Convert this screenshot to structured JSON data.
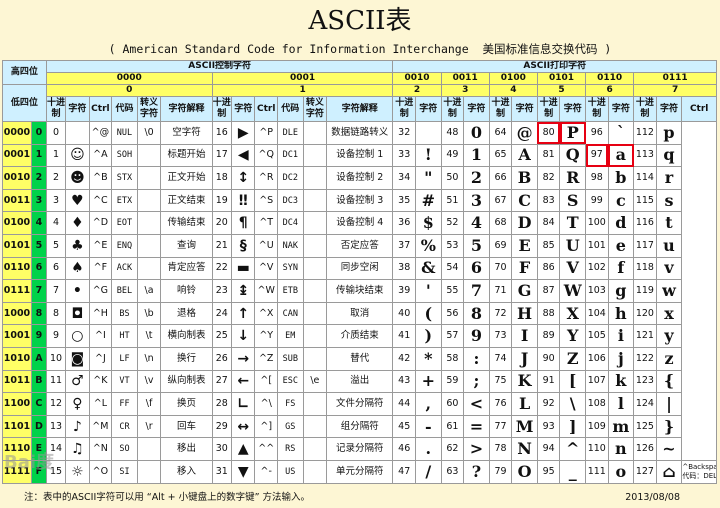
{
  "title": "ASCII表",
  "subtitle": "( American Standard Code for Information Interchange  美国标准信息交换代码 )",
  "corner_top": "高四位",
  "corner_bottom": "低四位",
  "ctrl_group": "ASCII控制字符",
  "print_group": "ASCII打印字符",
  "hi_bin": [
    "0000",
    "0001",
    "0010",
    "0011",
    "0100",
    "0101",
    "0110",
    "0111"
  ],
  "hi_hex": [
    "0",
    "1",
    "2",
    "3",
    "4",
    "5",
    "6",
    "7"
  ],
  "col_dec": "十进制",
  "col_char": "字符",
  "col_ctrl": "Ctrl",
  "col_code": "代码",
  "col_esc": "转义字符",
  "col_desc": "字符解释",
  "highlights": [
    [
      3,
      0
    ],
    [
      4,
      1
    ],
    [
      6,
      1
    ]
  ],
  "rows": [
    {
      "bin": "0000",
      "hex": "0",
      "c0": [
        "0",
        "",
        "^@",
        "NUL",
        "\\0",
        "空字符"
      ],
      "c1": [
        "16",
        "▶",
        "^P",
        "DLE",
        "",
        "数据链路转义"
      ],
      "p": [
        [
          "32",
          ""
        ],
        [
          "48",
          "0"
        ],
        [
          "64",
          "@"
        ],
        [
          "80",
          "P"
        ],
        [
          "96",
          "`"
        ],
        [
          "112",
          "p"
        ]
      ]
    },
    {
      "bin": "0001",
      "hex": "1",
      "c0": [
        "1",
        "☺",
        "^A",
        "SOH",
        "",
        "标题开始"
      ],
      "c1": [
        "17",
        "◀",
        "^Q",
        "DC1",
        "",
        "设备控制 1"
      ],
      "p": [
        [
          "33",
          "!"
        ],
        [
          "49",
          "1"
        ],
        [
          "65",
          "A"
        ],
        [
          "81",
          "Q"
        ],
        [
          "97",
          "a"
        ],
        [
          "113",
          "q"
        ]
      ]
    },
    {
      "bin": "0010",
      "hex": "2",
      "c0": [
        "2",
        "☻",
        "^B",
        "STX",
        "",
        "正文开始"
      ],
      "c1": [
        "18",
        "↕",
        "^R",
        "DC2",
        "",
        "设备控制 2"
      ],
      "p": [
        [
          "34",
          "\""
        ],
        [
          "50",
          "2"
        ],
        [
          "66",
          "B"
        ],
        [
          "82",
          "R"
        ],
        [
          "98",
          "b"
        ],
        [
          "114",
          "r"
        ]
      ]
    },
    {
      "bin": "0011",
      "hex": "3",
      "c0": [
        "3",
        "♥",
        "^C",
        "ETX",
        "",
        "正文结束"
      ],
      "c1": [
        "19",
        "‼",
        "^S",
        "DC3",
        "",
        "设备控制 3"
      ],
      "p": [
        [
          "35",
          "#"
        ],
        [
          "51",
          "3"
        ],
        [
          "67",
          "C"
        ],
        [
          "83",
          "S"
        ],
        [
          "99",
          "c"
        ],
        [
          "115",
          "s"
        ]
      ]
    },
    {
      "bin": "0100",
      "hex": "4",
      "c0": [
        "4",
        "♦",
        "^D",
        "EOT",
        "",
        "传输结束"
      ],
      "c1": [
        "20",
        "¶",
        "^T",
        "DC4",
        "",
        "设备控制 4"
      ],
      "p": [
        [
          "36",
          "$"
        ],
        [
          "52",
          "4"
        ],
        [
          "68",
          "D"
        ],
        [
          "84",
          "T"
        ],
        [
          "100",
          "d"
        ],
        [
          "116",
          "t"
        ]
      ]
    },
    {
      "bin": "0101",
      "hex": "5",
      "c0": [
        "5",
        "♣",
        "^E",
        "ENQ",
        "",
        "查询"
      ],
      "c1": [
        "21",
        "§",
        "^U",
        "NAK",
        "",
        "否定应答"
      ],
      "p": [
        [
          "37",
          "%"
        ],
        [
          "53",
          "5"
        ],
        [
          "69",
          "E"
        ],
        [
          "85",
          "U"
        ],
        [
          "101",
          "e"
        ],
        [
          "117",
          "u"
        ]
      ]
    },
    {
      "bin": "0110",
      "hex": "6",
      "c0": [
        "6",
        "♠",
        "^F",
        "ACK",
        "",
        "肯定应答"
      ],
      "c1": [
        "22",
        "▬",
        "^V",
        "SYN",
        "",
        "同步空闲"
      ],
      "p": [
        [
          "38",
          "&"
        ],
        [
          "54",
          "6"
        ],
        [
          "70",
          "F"
        ],
        [
          "86",
          "V"
        ],
        [
          "102",
          "f"
        ],
        [
          "118",
          "v"
        ]
      ]
    },
    {
      "bin": "0111",
      "hex": "7",
      "c0": [
        "7",
        "•",
        "^G",
        "BEL",
        "\\a",
        "响铃"
      ],
      "c1": [
        "23",
        "↨",
        "^W",
        "ETB",
        "",
        "传输块结束"
      ],
      "p": [
        [
          "39",
          "'"
        ],
        [
          "55",
          "7"
        ],
        [
          "71",
          "G"
        ],
        [
          "87",
          "W"
        ],
        [
          "103",
          "g"
        ],
        [
          "119",
          "w"
        ]
      ]
    },
    {
      "bin": "1000",
      "hex": "8",
      "c0": [
        "8",
        "◘",
        "^H",
        "BS",
        "\\b",
        "退格"
      ],
      "c1": [
        "24",
        "↑",
        "^X",
        "CAN",
        "",
        "取消"
      ],
      "p": [
        [
          "40",
          "("
        ],
        [
          "56",
          "8"
        ],
        [
          "72",
          "H"
        ],
        [
          "88",
          "X"
        ],
        [
          "104",
          "h"
        ],
        [
          "120",
          "x"
        ]
      ]
    },
    {
      "bin": "1001",
      "hex": "9",
      "c0": [
        "9",
        "○",
        "^I",
        "HT",
        "\\t",
        "横向制表"
      ],
      "c1": [
        "25",
        "↓",
        "^Y",
        "EM",
        "",
        "介质结束"
      ],
      "p": [
        [
          "41",
          ")"
        ],
        [
          "57",
          "9"
        ],
        [
          "73",
          "I"
        ],
        [
          "89",
          "Y"
        ],
        [
          "105",
          "i"
        ],
        [
          "121",
          "y"
        ]
      ]
    },
    {
      "bin": "1010",
      "hex": "A",
      "c0": [
        "10",
        "◙",
        "^J",
        "LF",
        "\\n",
        "换行"
      ],
      "c1": [
        "26",
        "→",
        "^Z",
        "SUB",
        "",
        "替代"
      ],
      "p": [
        [
          "42",
          "*"
        ],
        [
          "58",
          ":"
        ],
        [
          "74",
          "J"
        ],
        [
          "90",
          "Z"
        ],
        [
          "106",
          "j"
        ],
        [
          "122",
          "z"
        ]
      ]
    },
    {
      "bin": "1011",
      "hex": "B",
      "c0": [
        "11",
        "♂",
        "^K",
        "VT",
        "\\v",
        "纵向制表"
      ],
      "c1": [
        "27",
        "←",
        "^[",
        "ESC",
        "\\e",
        "溢出"
      ],
      "p": [
        [
          "43",
          "+"
        ],
        [
          "59",
          ";"
        ],
        [
          "75",
          "K"
        ],
        [
          "91",
          "["
        ],
        [
          "107",
          "k"
        ],
        [
          "123",
          "{"
        ]
      ]
    },
    {
      "bin": "1100",
      "hex": "C",
      "c0": [
        "12",
        "♀",
        "^L",
        "FF",
        "\\f",
        "换页"
      ],
      "c1": [
        "28",
        "∟",
        "^\\",
        "FS",
        "",
        "文件分隔符"
      ],
      "p": [
        [
          "44",
          ","
        ],
        [
          "60",
          "<"
        ],
        [
          "76",
          "L"
        ],
        [
          "92",
          "\\"
        ],
        [
          "108",
          "l"
        ],
        [
          "124",
          "|"
        ]
      ]
    },
    {
      "bin": "1101",
      "hex": "D",
      "c0": [
        "13",
        "♪",
        "^M",
        "CR",
        "\\r",
        "回车"
      ],
      "c1": [
        "29",
        "↔",
        "^]",
        "GS",
        "",
        "组分隔符"
      ],
      "p": [
        [
          "45",
          "-"
        ],
        [
          "61",
          "="
        ],
        [
          "77",
          "M"
        ],
        [
          "93",
          "]"
        ],
        [
          "109",
          "m"
        ],
        [
          "125",
          "}"
        ]
      ]
    },
    {
      "bin": "1110",
      "hex": "E",
      "c0": [
        "14",
        "♫",
        "^N",
        "SO",
        "",
        "移出"
      ],
      "c1": [
        "30",
        "▲",
        "^^",
        "RS",
        "",
        "记录分隔符"
      ],
      "p": [
        [
          "46",
          "."
        ],
        [
          "62",
          ">"
        ],
        [
          "78",
          "N"
        ],
        [
          "94",
          "^"
        ],
        [
          "110",
          "n"
        ],
        [
          "126",
          "~"
        ]
      ]
    },
    {
      "bin": "1111",
      "hex": "F",
      "c0": [
        "15",
        "☼",
        "^O",
        "SI",
        "",
        "移入"
      ],
      "c1": [
        "31",
        "▼",
        "^-",
        "US",
        "",
        "单元分隔符"
      ],
      "p": [
        [
          "47",
          "/"
        ],
        [
          "63",
          "?"
        ],
        [
          "79",
          "O"
        ],
        [
          "95",
          "_"
        ],
        [
          "111",
          "o"
        ],
        [
          "127",
          "⌂"
        ]
      ]
    }
  ],
  "del_ctrl": "^Backspace\n代码：DEL",
  "note": "注：表中的ASCII字符可以用 “Alt + 小键盘上的数字键” 方法输入。",
  "date": "2013/08/08",
  "watermark": "Bai度"
}
